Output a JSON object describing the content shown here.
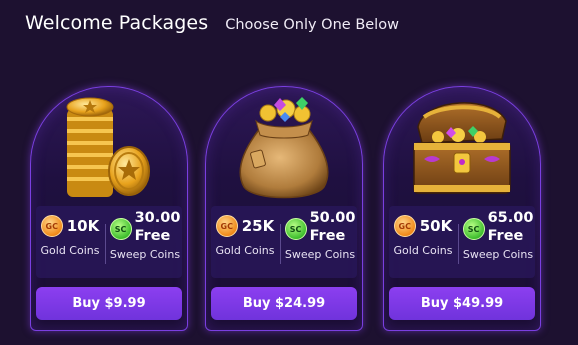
{
  "header": {
    "title": "Welcome Packages",
    "subtitle": "Choose Only One Below"
  },
  "colors": {
    "background": "#1d1130",
    "card_border": "#7a3fe0",
    "button": "#7c38e6",
    "gold_coin": "#f08a1a",
    "sweep_coin": "#3fbf2e"
  },
  "coin_icons": {
    "gold": "GC",
    "sweep": "SC"
  },
  "packages": [
    {
      "image": "gold-coin-stack",
      "gold_amount": "10K",
      "gold_label": "Gold Coins",
      "sweep_amount": "30.00",
      "sweep_free": "Free",
      "sweep_label": "Sweep Coins",
      "button": "Buy $9.99"
    },
    {
      "image": "coin-sack",
      "gold_amount": "25K",
      "gold_label": "Gold Coins",
      "sweep_amount": "50.00",
      "sweep_free": "Free",
      "sweep_label": "Sweep Coins",
      "button": "Buy $24.99"
    },
    {
      "image": "treasure-chest",
      "gold_amount": "50K",
      "gold_label": "Gold Coins",
      "sweep_amount": "65.00",
      "sweep_free": "Free",
      "sweep_label": "Sweep Coins",
      "button": "Buy $49.99"
    }
  ]
}
